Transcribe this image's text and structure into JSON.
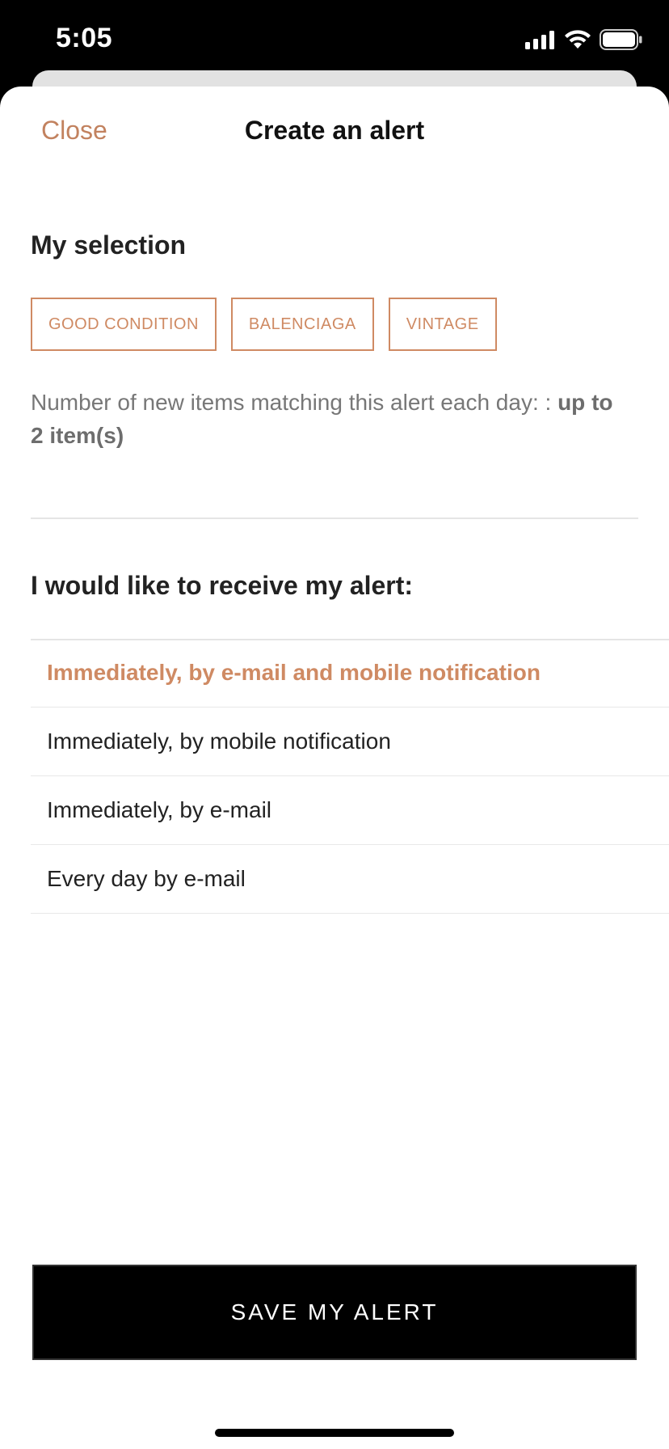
{
  "status_bar": {
    "time": "5:05"
  },
  "header": {
    "close_label": "Close",
    "title": "Create an alert"
  },
  "selection": {
    "title": "My selection",
    "chips": [
      "GOOD CONDITION",
      "BALENCIAGA",
      "VINTAGE"
    ],
    "count_prefix": "Number of new items matching this alert each day: : ",
    "count_value": "up to 2 item(s)"
  },
  "receive": {
    "title": "I would like to receive my alert:",
    "options": [
      "Immediately, by e-mail and mobile notification",
      "Immediately, by mobile notification",
      "Immediately, by e-mail",
      "Every day by e-mail"
    ],
    "selected_index": 0
  },
  "save_button_label": "SAVE MY ALERT",
  "colors": {
    "accent": "#cf8a63",
    "button_bg": "#000000"
  }
}
